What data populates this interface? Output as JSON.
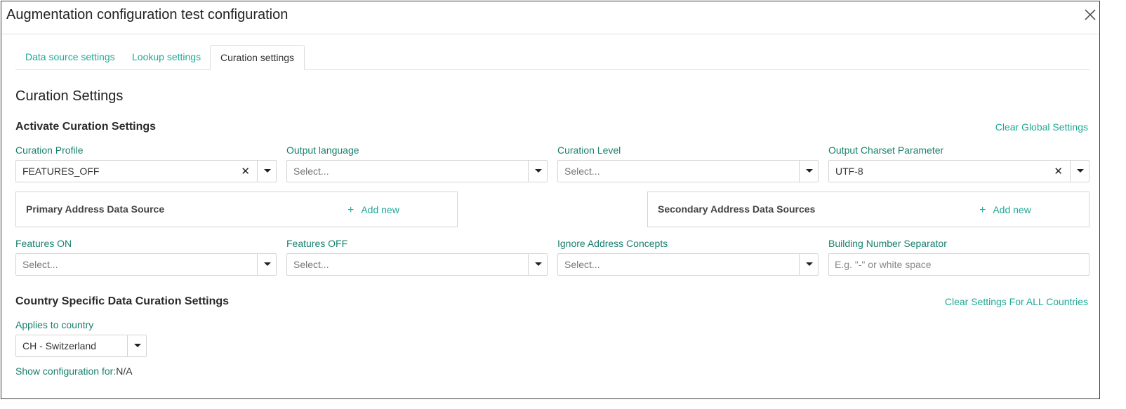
{
  "dialog": {
    "title": "Augmentation configuration test configuration"
  },
  "tabs": [
    {
      "label": "Data source settings"
    },
    {
      "label": "Lookup settings"
    },
    {
      "label": "Curation settings"
    }
  ],
  "page_title": "Curation Settings",
  "activate": {
    "heading": "Activate Curation Settings",
    "clear_link": "Clear Global Settings",
    "curation_profile": {
      "label": "Curation Profile",
      "value": "FEATURES_OFF"
    },
    "output_language": {
      "label": "Output language",
      "placeholder": "Select..."
    },
    "curation_level": {
      "label": "Curation Level",
      "placeholder": "Select..."
    },
    "output_charset": {
      "label": "Output Charset Parameter",
      "value": "UTF-8"
    },
    "primary_box": {
      "title": "Primary Address Data Source",
      "add_label": "Add new"
    },
    "secondary_box": {
      "title": "Secondary Address Data Sources",
      "add_label": "Add new"
    },
    "features_on": {
      "label": "Features ON",
      "placeholder": "Select..."
    },
    "features_off": {
      "label": "Features OFF",
      "placeholder": "Select..."
    },
    "ignore_concepts": {
      "label": "Ignore Address Concepts",
      "placeholder": "Select..."
    },
    "building_separator": {
      "label": "Building Number Separator",
      "placeholder": "E.g. \"-\" or white space"
    }
  },
  "country": {
    "heading": "Country Specific Data Curation Settings",
    "clear_link": "Clear Settings For ALL Countries",
    "applies_label": "Applies to country",
    "applies_value": "CH - Switzerland",
    "show_config_label": "Show configuration for:",
    "show_config_value": "N/A"
  },
  "icons": {
    "close": "close-icon",
    "clear": "clear-x-icon",
    "dropdown": "caret-down-icon",
    "add": "plus-icon"
  },
  "colors": {
    "accent": "#1fa896",
    "label": "#17806e"
  }
}
